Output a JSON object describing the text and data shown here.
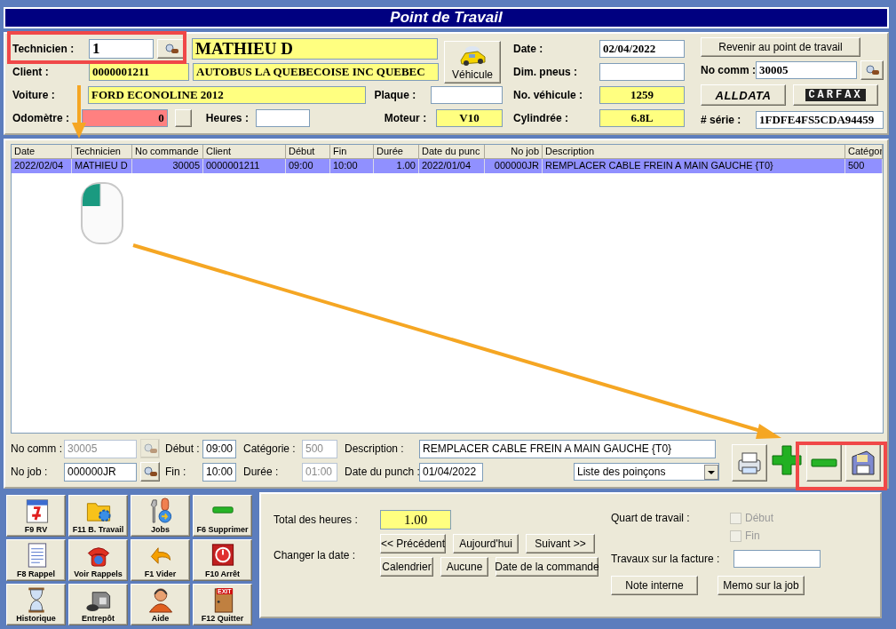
{
  "window": {
    "title": "Point de Travail"
  },
  "header": {
    "technicien": {
      "label": "Technicien :",
      "value": "1",
      "name": "MATHIEU D"
    },
    "client": {
      "label": "Client :",
      "code": "0000001211",
      "name": "AUTOBUS LA QUEBECOISE INC QUEBEC"
    },
    "vehicle_button": "Véhicule",
    "voiture": {
      "label": "Voiture :",
      "value": "FORD ECONOLINE 2012"
    },
    "plaque": {
      "label": "Plaque :"
    },
    "odometre": {
      "label": "Odomètre :",
      "value": "0"
    },
    "heures": {
      "label": "Heures :"
    },
    "moteur": {
      "label": "Moteur :",
      "value": "V10"
    },
    "date": {
      "label": "Date :",
      "value": "02/04/2022"
    },
    "dim_pneus": {
      "label": "Dim. pneus :"
    },
    "no_vehicule": {
      "label": "No. véhicule :",
      "value": "1259"
    },
    "cylindree": {
      "label": "Cylindrée :",
      "value": "6.8L"
    },
    "return_button": "Revenir au point de travail",
    "no_comm": {
      "label": "No comm :",
      "value": "30005"
    },
    "alldata_button": "ALLDATA",
    "carfax_button": "CARFAX",
    "serie": {
      "label": "# série :",
      "value": "1FDFE4FS5CDA94459"
    }
  },
  "table": {
    "columns": [
      "Date",
      "Technicien",
      "No commande",
      "Client",
      "Début",
      "Fin",
      "Durée",
      "Date du punc",
      "No job",
      "Description",
      "Catégor"
    ],
    "rows": [
      {
        "selected": true,
        "cells": [
          "2022/02/04",
          "MATHIEU D",
          "30005",
          "0000001211",
          "09:00",
          "10:00",
          "1.00",
          "2022/01/04",
          "000000JR",
          "REMPLACER CABLE FREIN A MAIN GAUCHE {T0}",
          "500"
        ]
      }
    ]
  },
  "edit": {
    "no_comm": {
      "label": "No comm :",
      "value": "30005",
      "disabled": true
    },
    "no_job": {
      "label": "No job :",
      "value": "000000JR",
      "disabled": false
    },
    "debut": {
      "label": "Début :",
      "value": "09:00",
      "disabled": false
    },
    "fin": {
      "label": "Fin :",
      "value": "10:00",
      "disabled": false
    },
    "categorie": {
      "label": "Catégorie :",
      "value": "500",
      "disabled": true
    },
    "duree": {
      "label": "Durée :",
      "value": "01:00",
      "disabled": true
    },
    "description": {
      "label": "Description :",
      "value": "REMPLACER CABLE FREIN A MAIN GAUCHE {T0}",
      "disabled": false
    },
    "date_punch": {
      "label": "Date du punch :",
      "value": "01/04/2022",
      "disabled": false
    },
    "punch_list": "Liste des poinçons"
  },
  "actions": [
    {
      "kind": "calendar",
      "label": "F9 RV"
    },
    {
      "kind": "folder",
      "label": "F11 B. Travail"
    },
    {
      "kind": "wrench",
      "label": "Jobs"
    },
    {
      "kind": "minus",
      "label": "F6 Supprimer"
    },
    {
      "kind": "document",
      "label": "F8 Rappel"
    },
    {
      "kind": "phone",
      "label": "Voir Rappels"
    },
    {
      "kind": "undo",
      "label": "F1 Vider"
    },
    {
      "kind": "power",
      "label": "F10 Arrêt"
    },
    {
      "kind": "hourglass",
      "label": "Historique"
    },
    {
      "kind": "machine",
      "label": "Entrepôt"
    },
    {
      "kind": "person",
      "label": "Aide"
    },
    {
      "kind": "exit",
      "label": "F12 Quitter",
      "sign": "EXIT"
    }
  ],
  "summary": {
    "total_label": "Total des heures :",
    "total": "1.00",
    "shift_label": "Quart de travail :",
    "shift_options": [
      {
        "label": "Début",
        "checked": false,
        "disabled": true
      },
      {
        "label": "Fin",
        "checked": false,
        "disabled": true
      }
    ],
    "date_label": "Changer la date :",
    "date_buttons": [
      "<< Précédent",
      "Aujourd'hui",
      "Suivant >>",
      "Calendrier",
      "Aucune",
      "Date de la commande"
    ],
    "invoice_label": "Travaux sur la facture :",
    "note_button": "Note interne",
    "memo_button": "Memo sur la job"
  }
}
